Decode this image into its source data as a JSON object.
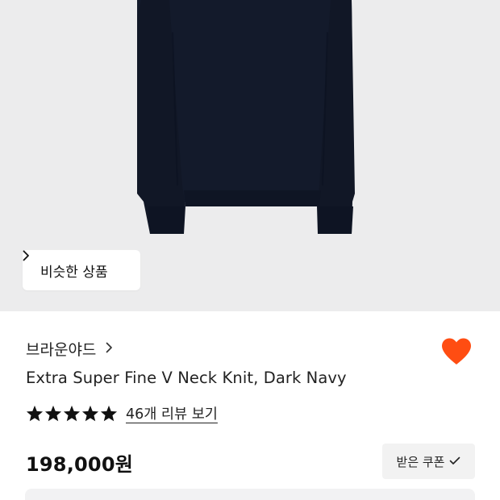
{
  "similar_button": {
    "label": "비슷한 상품"
  },
  "brand": {
    "name": "브라운야드"
  },
  "product": {
    "title": "Extra Super Fine V Neck Knit, Dark Navy",
    "color": "#111827"
  },
  "rating": {
    "stars": 5,
    "max": 5,
    "review_link": "46개 리뷰 보기"
  },
  "price": {
    "value": "198,000원"
  },
  "coupon_button": {
    "label": "받은 쿠폰"
  },
  "colors": {
    "hero_bg": "#ececed",
    "heart": "#ff4d12",
    "panel_bg": "#f2f2f3"
  },
  "icons": {
    "similar_chevron": "chevron-right-icon",
    "brand_chevron": "chevron-right-icon",
    "wishlist": "heart-icon",
    "coupon_check": "check-icon",
    "star": "star-icon"
  }
}
